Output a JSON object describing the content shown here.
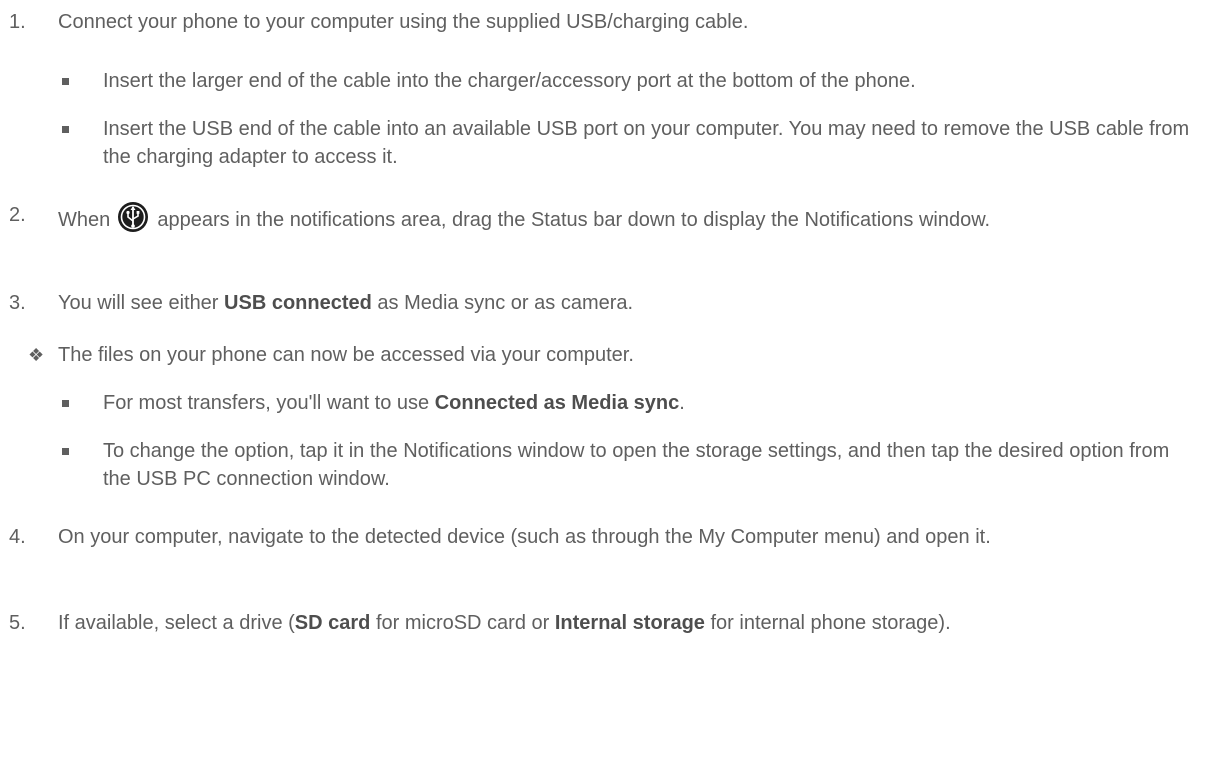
{
  "steps": [
    {
      "number": "1.",
      "text": "Connect your phone to your computer using the supplied USB/charging cable.",
      "subitems": [
        "Insert the larger end of the cable into the charger/accessory port at the bottom of the phone.",
        "Insert the USB end of the cable into an available USB port on your computer. You may need to remove the USB cable from the charging adapter to access it."
      ]
    },
    {
      "number": "2.",
      "text_before_icon": "When",
      "icon": "usb-connection-icon",
      "text_after_icon": "appears in the notifications area, drag the Status bar down to display the Notifications window."
    },
    {
      "number": "3.",
      "text_before": "You will see either",
      "bold": "USB connected",
      "text_after": "as Media sync or as camera.",
      "result": "The files on your phone can now be accessed via your computer.",
      "subitems": [
        {
          "text_before": "For most transfers, you'll want to use",
          "bold": "Connected as Media sync",
          "text_after": "."
        },
        {
          "text": "To change the option, tap it in the Notifications window to open the storage settings, and then tap the desired option from the USB PC connection window."
        }
      ]
    },
    {
      "number": "4.",
      "text": "On your computer, navigate to the detected device (such as through the My Computer menu) and open it."
    },
    {
      "number": "5.",
      "text_1": "If available, select a drive (",
      "bold_1": "SD card",
      "text_2": "for microSD card or",
      "bold_2": "Internal storage",
      "text_3": "for internal phone storage)."
    }
  ],
  "colors": {
    "text": "#5f5f5f",
    "background": "#ffffff"
  }
}
